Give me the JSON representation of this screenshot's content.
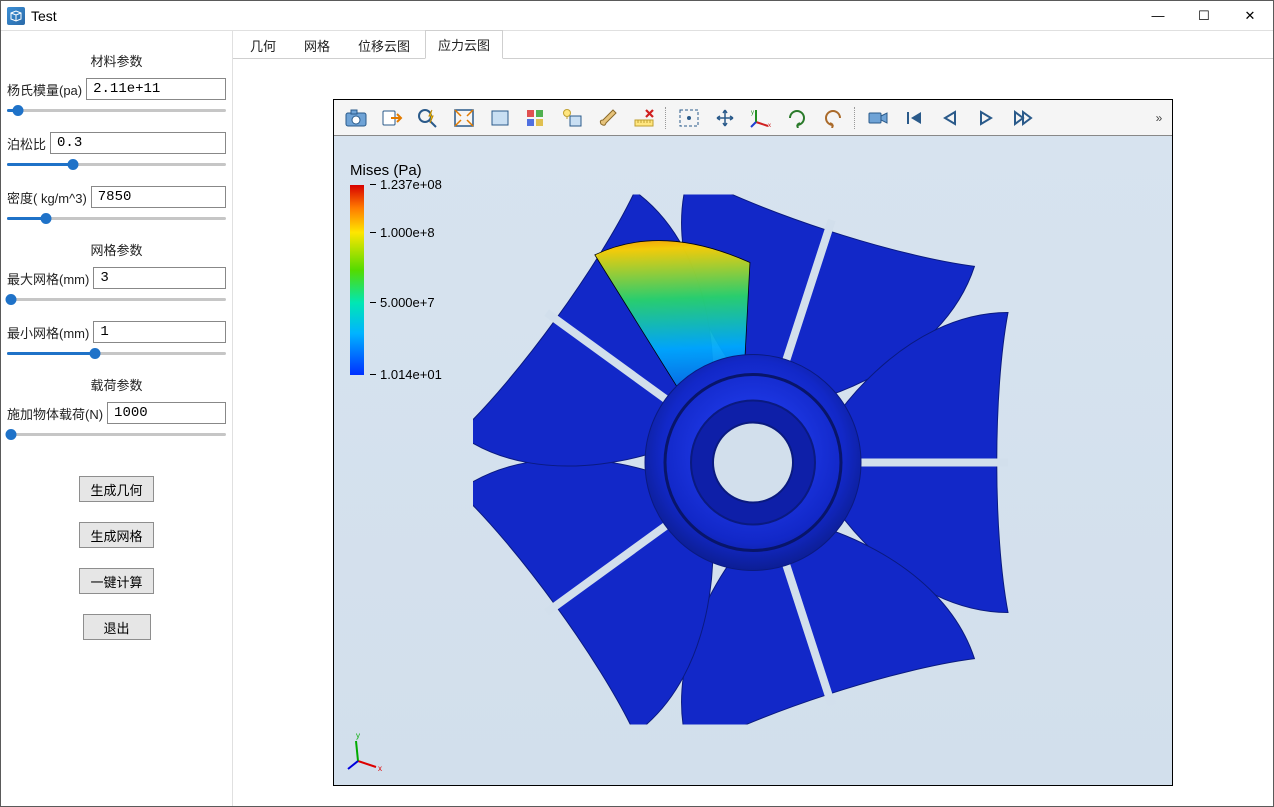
{
  "window": {
    "title": "Test"
  },
  "titlebar_controls": {
    "min": "—",
    "max": "☐",
    "close": "✕"
  },
  "sidebar": {
    "section_material": "材料参数",
    "youngs_label": "杨氏模量(pa)",
    "youngs_value": "2.11e+11",
    "youngs_slider_pct": 5,
    "poisson_label": "泊松比",
    "poisson_value": "0.3",
    "poisson_slider_pct": 30,
    "density_label": "密度( kg/m^3)",
    "density_value": "7850",
    "density_slider_pct": 18,
    "section_mesh": "网格参数",
    "maxmesh_label": "最大网格(mm)",
    "maxmesh_value": "3",
    "maxmesh_slider_pct": 2,
    "minmesh_label": "最小网格(mm)",
    "minmesh_value": "1",
    "minmesh_slider_pct": 40,
    "section_load": "载荷参数",
    "load_label": "施加物体载荷(N)",
    "load_value": "1000",
    "load_slider_pct": 2,
    "buttons": {
      "gen_geom": "生成几何",
      "gen_mesh": "生成网格",
      "compute": "一键计算",
      "exit": "退出"
    }
  },
  "tabs": [
    {
      "id": "tab-geom",
      "label": "几何",
      "active": false
    },
    {
      "id": "tab-mesh",
      "label": "网格",
      "active": false
    },
    {
      "id": "tab-disp",
      "label": "位移云图",
      "active": false
    },
    {
      "id": "tab-stress",
      "label": "应力云图",
      "active": true
    }
  ],
  "toolbar_icons": [
    "camera-icon",
    "export-icon",
    "zoom-lightning-icon",
    "fit-window-icon",
    "box-select-icon",
    "color-blocks-icon",
    "lightbulb-box-icon",
    "brush-icon",
    "ruler-delete-icon",
    "sep",
    "lasso-select-icon",
    "move-icon",
    "xyz-axes-icon",
    "rotate-cw-icon",
    "rotate-ccw-icon",
    "sep",
    "video-camera-icon",
    "skip-start-icon",
    "step-back-icon",
    "play-icon",
    "step-forward-icon"
  ],
  "toolbar_overflow": "»",
  "legend": {
    "title": "Mises (Pa)",
    "ticks": [
      {
        "pos_pct": 0,
        "label": "1.237e+08"
      },
      {
        "pos_pct": 25,
        "label": "1.000e+8"
      },
      {
        "pos_pct": 62,
        "label": "5.000e+7"
      },
      {
        "pos_pct": 100,
        "label": "1.014e+01"
      }
    ]
  },
  "triad": {
    "x": "x",
    "y": "y",
    "z": "z"
  },
  "colors": {
    "model_main": "#1228c8",
    "model_edge": "#0a1a80",
    "stress_high": "#ff3a00",
    "stress_mid": "#2bd66a",
    "stress_low": "#00aaff",
    "viewport_bg_top": "#d7e3ef",
    "viewport_bg_bot": "#d2dfec"
  }
}
